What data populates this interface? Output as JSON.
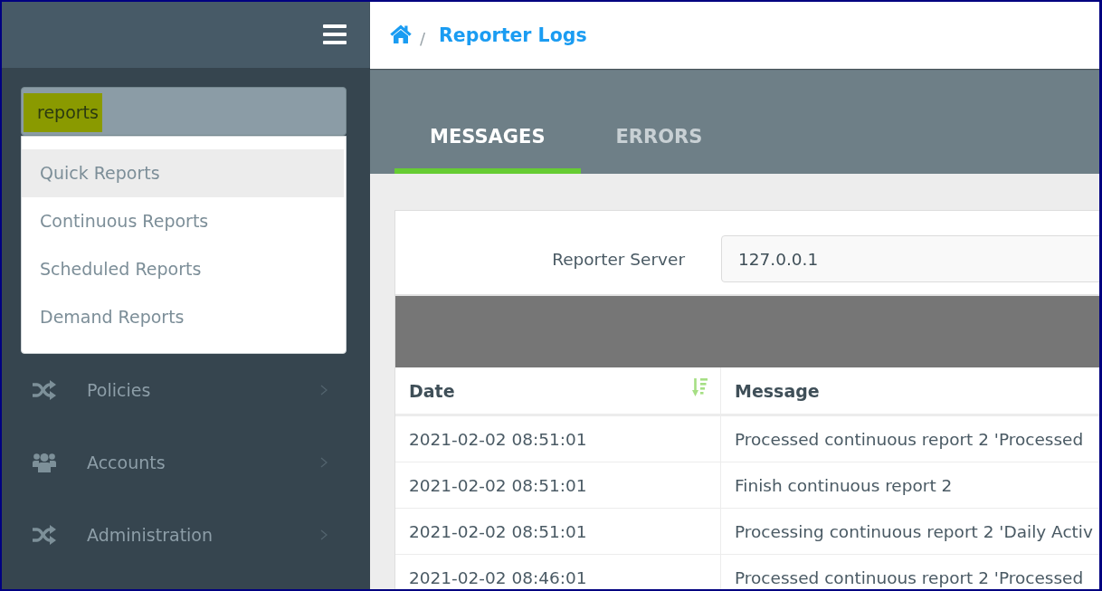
{
  "sidebar": {
    "search": {
      "value": "reports",
      "highlighted": true
    },
    "suggestions": [
      {
        "label": "Quick Reports",
        "selected": true
      },
      {
        "label": "Continuous Reports",
        "selected": false
      },
      {
        "label": "Scheduled Reports",
        "selected": false
      },
      {
        "label": "Demand Reports",
        "selected": false
      }
    ],
    "nav_items": [
      {
        "label": "Policies",
        "expanded": false
      },
      {
        "label": "Accounts",
        "expanded": false
      },
      {
        "label": "Administration",
        "expanded": false
      }
    ]
  },
  "breadcrumb": {
    "separator": "/",
    "current": "Reporter Logs"
  },
  "tabs": [
    {
      "label": "MESSAGES",
      "selected": true
    },
    {
      "label": "ERRORS",
      "selected": false
    }
  ],
  "filter": {
    "label": "Reporter Server",
    "value": "127.0.0.1"
  },
  "table": {
    "columns": [
      {
        "label": "Date",
        "sorted": true
      },
      {
        "label": "Message",
        "sorted": false
      }
    ],
    "rows": [
      [
        "2021-02-02 08:51:01",
        "Processed continuous report 2 'Processed"
      ],
      [
        "2021-02-02 08:51:01",
        "Finish continuous report 2"
      ],
      [
        "2021-02-02 08:51:01",
        "Processing continuous report 2 'Daily Activ"
      ],
      [
        "2021-02-02 08:46:01",
        "Processed continuous report 2 'Processed"
      ]
    ]
  }
}
